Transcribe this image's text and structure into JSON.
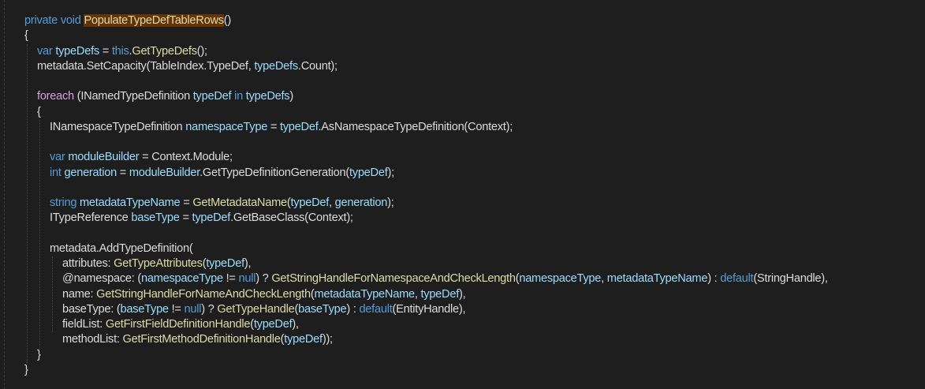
{
  "colors": {
    "background": "#1e1e1e",
    "keyword": "#569cd6",
    "control_keyword": "#d8a0df",
    "method": "#dcdcaa",
    "type": "#4ec9b0",
    "identifier": "#9cdcfe",
    "plain": "#dcdcdc",
    "highlight": "#653306"
  },
  "code_lines": [
    {
      "tokens": [
        {
          "t": "private void ",
          "c": "kw"
        },
        {
          "t": "PopulateTypeDefTableRows",
          "c": "mhl"
        },
        {
          "t": "()",
          "c": "pl"
        }
      ]
    },
    {
      "tokens": [
        {
          "t": "{",
          "c": "pl"
        }
      ]
    },
    {
      "tokens": [
        {
          "t": "var ",
          "c": "kw"
        },
        {
          "t": "typeDefs",
          "c": "id"
        },
        {
          "t": " = ",
          "c": "pl"
        },
        {
          "t": "this",
          "c": "kw"
        },
        {
          "t": ".",
          "c": "pl"
        },
        {
          "t": "GetTypeDefs",
          "c": "m"
        },
        {
          "t": "();",
          "c": "pl"
        }
      ]
    },
    {
      "tokens": [
        {
          "t": "metadata.",
          "c": "pl"
        },
        {
          "t": "SetCapacity",
          "c": "pl"
        },
        {
          "t": "(TableIndex.TypeDef, ",
          "c": "pl"
        },
        {
          "t": "typeDefs",
          "c": "id"
        },
        {
          "t": ".Count);",
          "c": "pl"
        }
      ]
    },
    {
      "tokens": []
    },
    {
      "tokens": [
        {
          "t": "foreach",
          "c": "ck"
        },
        {
          "t": " (INamedTypeDefinition ",
          "c": "pl"
        },
        {
          "t": "typeDef",
          "c": "id"
        },
        {
          "t": " in ",
          "c": "kw"
        },
        {
          "t": "typeDefs",
          "c": "id"
        },
        {
          "t": ")",
          "c": "pl"
        }
      ]
    },
    {
      "tokens": [
        {
          "t": "{",
          "c": "pl"
        }
      ]
    },
    {
      "tokens": [
        {
          "t": "INamespaceTypeDefinition ",
          "c": "pl"
        },
        {
          "t": "namespaceType",
          "c": "id"
        },
        {
          "t": " = ",
          "c": "pl"
        },
        {
          "t": "typeDef",
          "c": "id"
        },
        {
          "t": ".AsNamespaceTypeDefinition(Context);",
          "c": "pl"
        }
      ]
    },
    {
      "tokens": []
    },
    {
      "tokens": [
        {
          "t": "var ",
          "c": "kw"
        },
        {
          "t": "moduleBuilder",
          "c": "id"
        },
        {
          "t": " = Context.Module;",
          "c": "pl"
        }
      ]
    },
    {
      "tokens": [
        {
          "t": "int ",
          "c": "kw"
        },
        {
          "t": "generation",
          "c": "id"
        },
        {
          "t": " = ",
          "c": "pl"
        },
        {
          "t": "moduleBuilder",
          "c": "id"
        },
        {
          "t": ".GetTypeDefinitionGeneration(",
          "c": "pl"
        },
        {
          "t": "typeDef",
          "c": "id"
        },
        {
          "t": ");",
          "c": "pl"
        }
      ]
    },
    {
      "tokens": []
    },
    {
      "tokens": [
        {
          "t": "string ",
          "c": "kw"
        },
        {
          "t": "metadataTypeName",
          "c": "id"
        },
        {
          "t": " = ",
          "c": "pl"
        },
        {
          "t": "GetMetadataName",
          "c": "m"
        },
        {
          "t": "(",
          "c": "pl"
        },
        {
          "t": "typeDef",
          "c": "id"
        },
        {
          "t": ", ",
          "c": "pl"
        },
        {
          "t": "generation",
          "c": "id"
        },
        {
          "t": ");",
          "c": "pl"
        }
      ]
    },
    {
      "tokens": [
        {
          "t": "ITypeReference ",
          "c": "pl"
        },
        {
          "t": "baseType",
          "c": "id"
        },
        {
          "t": " = ",
          "c": "pl"
        },
        {
          "t": "typeDef",
          "c": "id"
        },
        {
          "t": ".GetBaseClass(Context);",
          "c": "pl"
        }
      ]
    },
    {
      "tokens": []
    },
    {
      "tokens": [
        {
          "t": "metadata.AddTypeDefinition(",
          "c": "pl"
        }
      ]
    },
    {
      "tokens": [
        {
          "t": "attributes: ",
          "c": "pl"
        },
        {
          "t": "GetTypeAttributes",
          "c": "m"
        },
        {
          "t": "(",
          "c": "pl"
        },
        {
          "t": "typeDef",
          "c": "id"
        },
        {
          "t": "),",
          "c": "pl"
        }
      ]
    },
    {
      "tokens": [
        {
          "t": "@namespace: (",
          "c": "pl"
        },
        {
          "t": "namespaceType",
          "c": "id"
        },
        {
          "t": " != ",
          "c": "pl"
        },
        {
          "t": "null",
          "c": "kw"
        },
        {
          "t": ") ? ",
          "c": "pl"
        },
        {
          "t": "GetStringHandleForNamespaceAndCheckLength",
          "c": "m"
        },
        {
          "t": "(",
          "c": "pl"
        },
        {
          "t": "namespaceType",
          "c": "id"
        },
        {
          "t": ", ",
          "c": "pl"
        },
        {
          "t": "metadataTypeName",
          "c": "id"
        },
        {
          "t": ") : ",
          "c": "pl"
        },
        {
          "t": "default",
          "c": "kw"
        },
        {
          "t": "(StringHandle),",
          "c": "pl"
        }
      ]
    },
    {
      "tokens": [
        {
          "t": "name: ",
          "c": "pl"
        },
        {
          "t": "GetStringHandleForNameAndCheckLength",
          "c": "m"
        },
        {
          "t": "(",
          "c": "pl"
        },
        {
          "t": "metadataTypeName",
          "c": "id"
        },
        {
          "t": ", ",
          "c": "pl"
        },
        {
          "t": "typeDef",
          "c": "id"
        },
        {
          "t": "),",
          "c": "pl"
        }
      ]
    },
    {
      "tokens": [
        {
          "t": "baseType: (",
          "c": "pl"
        },
        {
          "t": "baseType",
          "c": "id"
        },
        {
          "t": " != ",
          "c": "pl"
        },
        {
          "t": "null",
          "c": "kw"
        },
        {
          "t": ") ? ",
          "c": "pl"
        },
        {
          "t": "GetTypeHandle",
          "c": "m"
        },
        {
          "t": "(",
          "c": "pl"
        },
        {
          "t": "baseType",
          "c": "id"
        },
        {
          "t": ") : ",
          "c": "pl"
        },
        {
          "t": "default",
          "c": "kw"
        },
        {
          "t": "(EntityHandle),",
          "c": "pl"
        }
      ]
    },
    {
      "tokens": [
        {
          "t": "fieldList: ",
          "c": "pl"
        },
        {
          "t": "GetFirstFieldDefinitionHandle",
          "c": "m"
        },
        {
          "t": "(",
          "c": "pl"
        },
        {
          "t": "typeDef",
          "c": "id"
        },
        {
          "t": "),",
          "c": "pl"
        }
      ]
    },
    {
      "tokens": [
        {
          "t": "methodList: ",
          "c": "pl"
        },
        {
          "t": "GetFirstMethodDefinitionHandle",
          "c": "m"
        },
        {
          "t": "(",
          "c": "pl"
        },
        {
          "t": "typeDef",
          "c": "id"
        },
        {
          "t": "));",
          "c": "pl"
        }
      ]
    },
    {
      "tokens": [
        {
          "t": "}",
          "c": "pl"
        }
      ]
    },
    {
      "tokens": [
        {
          "t": "}",
          "c": "pl"
        }
      ]
    }
  ]
}
